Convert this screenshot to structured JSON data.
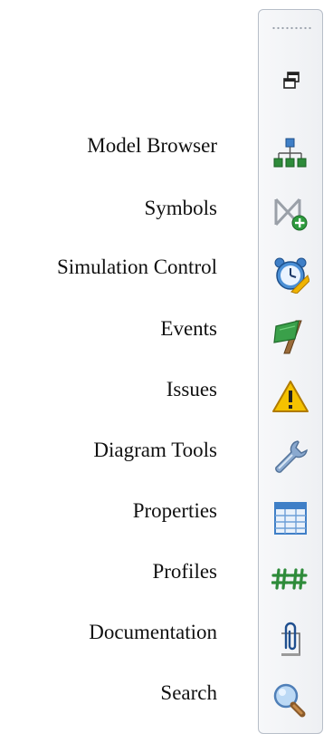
{
  "panels": [
    {
      "label": "Model Browser",
      "icon": "model-browser-icon"
    },
    {
      "label": "Symbols",
      "icon": "symbols-icon"
    },
    {
      "label": "Simulation Control",
      "icon": "simulation-control-icon"
    },
    {
      "label": "Events",
      "icon": "events-icon"
    },
    {
      "label": "Issues",
      "icon": "warning-icon"
    },
    {
      "label": "Diagram Tools",
      "icon": "wrench-icon"
    },
    {
      "label": "Properties",
      "icon": "properties-table-icon"
    },
    {
      "label": "Profiles",
      "icon": "profiles-icon"
    },
    {
      "label": "Documentation",
      "icon": "paperclip-icon"
    },
    {
      "label": "Search",
      "icon": "magnifier-icon"
    }
  ],
  "toolbar": {
    "restore_icon": "restore-window-icon",
    "grip_icon": "grip-handle-icon"
  },
  "colors": {
    "toolbar_border": "#b7bec8",
    "label_text": "#111111",
    "green": "#2e8b3a",
    "blue": "#3f7fc7",
    "warning": "#f0b400"
  }
}
